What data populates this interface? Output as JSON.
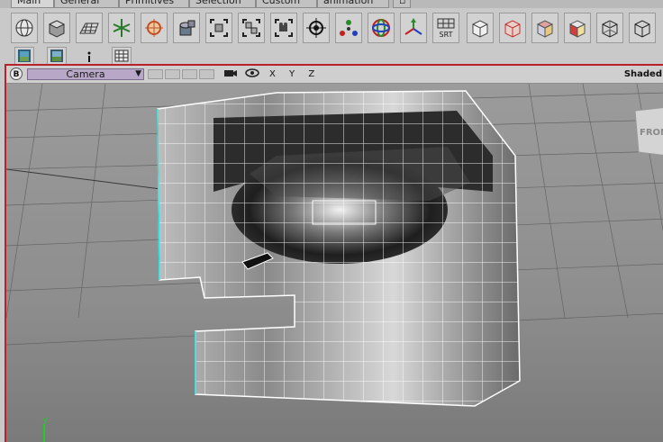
{
  "tabs": [
    {
      "label": "Main",
      "active": true
    },
    {
      "label": "General"
    },
    {
      "label": "Primitives"
    },
    {
      "label": "Selection"
    },
    {
      "label": "Custom"
    },
    {
      "label": "animation"
    }
  ],
  "toolbar": {
    "tools": [
      "sphere-icon",
      "cube-icon",
      "plane-grid-icon",
      "joint-star-icon",
      "target-crosshair-icon",
      "cylinder-icon",
      "object-frame-icon",
      "group-frame-icon",
      "camera-frame-icon",
      "snap-target-icon",
      "points-icon",
      "rotate-gizmo-icon",
      "axis-gizmo-icon",
      "srt-icon",
      "box-view-icon",
      "box-red-icon",
      "box-colored-icon",
      "box-red-face-icon",
      "box-wire-icon",
      "box-outline-icon"
    ],
    "srt_label": "SRT",
    "row2": [
      "scene-icon",
      "scene-icon-2",
      "dot-icon",
      "grid-icon"
    ]
  },
  "viewport": {
    "b_label": "B",
    "camera_label": "Camera",
    "camera_arrow": "▼",
    "xyz_label": "X Y Z",
    "shaded_label": "Shaded",
    "front_label": "FRON",
    "axis_y_label": "Y"
  }
}
